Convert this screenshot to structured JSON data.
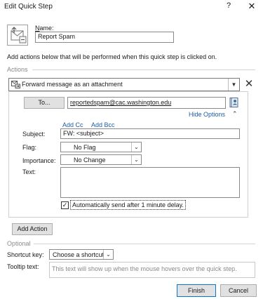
{
  "window": {
    "title": "Edit Quick Step",
    "help_glyph": "?",
    "close_glyph": "✕"
  },
  "header": {
    "icon": "quick-step-icon",
    "name_label_prefix": "N",
    "name_label_rest": "ame:",
    "name_value": "Report Spam",
    "intro": "Add actions below that will be performed when this quick step is clicked on."
  },
  "actions_section": {
    "label": "Actions",
    "action": {
      "icon": "forward-attachment-icon",
      "label": "Forward message as an attachment",
      "dropdown_icon": "chevron-down-icon",
      "delete_icon": "close-icon",
      "delete_glyph": "✕"
    },
    "to_button": "To...",
    "to_value": "reportedspam@cac.washington.edu",
    "address_book_icon": "address-book-icon",
    "hide_options": "Hide Options",
    "hide_options_glyph": "⌃",
    "add_cc": "Add Cc",
    "add_bcc": "Add Bcc",
    "subject_label": "Subject:",
    "subject_value": "FW: <subject>",
    "flag_label": "Flag:",
    "flag_value": "No Flag",
    "importance_label": "Importance:",
    "importance_value": "No Change",
    "text_label": "Text:",
    "text_value": "",
    "auto_send_checked": true,
    "check_glyph": "✓",
    "auto_send_label": "Automatically send after 1 minute delay."
  },
  "add_action_button": "Add Action",
  "optional_section": {
    "label": "Optional",
    "shortcut_label": "Shortcut key:",
    "shortcut_value": "Choose a shortcut",
    "tooltip_label": "Tooltip text:",
    "tooltip_placeholder": "This text will show up when the mouse hovers over the quick step."
  },
  "footer": {
    "finish": "Finish",
    "cancel": "Cancel"
  },
  "colors": {
    "link": "#1a5ea8",
    "focus_border": "#0078d7",
    "section_label": "#8a8a8a"
  }
}
